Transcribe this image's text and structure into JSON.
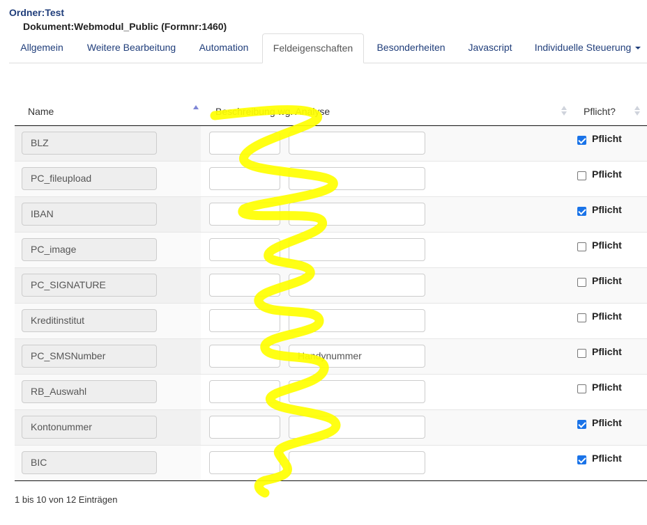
{
  "header": {
    "folder": "Ordner:Test",
    "document": "Dokument:Webmodul_Public (Formnr:1460)"
  },
  "tabs": [
    {
      "label": "Allgemein",
      "active": false
    },
    {
      "label": "Weitere Bearbeitung",
      "active": false
    },
    {
      "label": "Automation",
      "active": false
    },
    {
      "label": "Feldeigenschaften",
      "active": true
    },
    {
      "label": "Besonderheiten",
      "active": false
    },
    {
      "label": "Javascript",
      "active": false
    },
    {
      "label": "Individuelle Steuerung",
      "active": false,
      "dropdown": true
    }
  ],
  "table": {
    "columns": {
      "name": "Name",
      "description": "Beschreibung wg. Analyse",
      "required": "Pflicht?"
    },
    "rows": [
      {
        "name": "BLZ",
        "description": "",
        "required": true,
        "required_label": "Pflicht"
      },
      {
        "name": "PC_fileupload",
        "description": "",
        "required": false,
        "required_label": "Pflicht"
      },
      {
        "name": "IBAN",
        "description": "",
        "required": true,
        "required_label": "Pflicht"
      },
      {
        "name": "PC_image",
        "description": "",
        "required": false,
        "required_label": "Pflicht"
      },
      {
        "name": "PC_SIGNATURE",
        "description": "",
        "required": false,
        "required_label": "Pflicht"
      },
      {
        "name": "Kreditinstitut",
        "description": "",
        "required": false,
        "required_label": "Pflicht"
      },
      {
        "name": "PC_SMSNumber",
        "description": "Handynummer",
        "required": false,
        "required_label": "Pflicht"
      },
      {
        "name": "RB_Auswahl",
        "description": "",
        "required": false,
        "required_label": "Pflicht"
      },
      {
        "name": "Kontonummer",
        "description": "",
        "required": true,
        "required_label": "Pflicht"
      },
      {
        "name": "BIC",
        "description": "",
        "required": true,
        "required_label": "Pflicht"
      }
    ]
  },
  "footer": {
    "info": "1 bis 10 von 12 Einträgen"
  },
  "colors": {
    "link": "#1f3d7a",
    "checkbox": "#1a73e8",
    "highlight": "#ffff00"
  }
}
